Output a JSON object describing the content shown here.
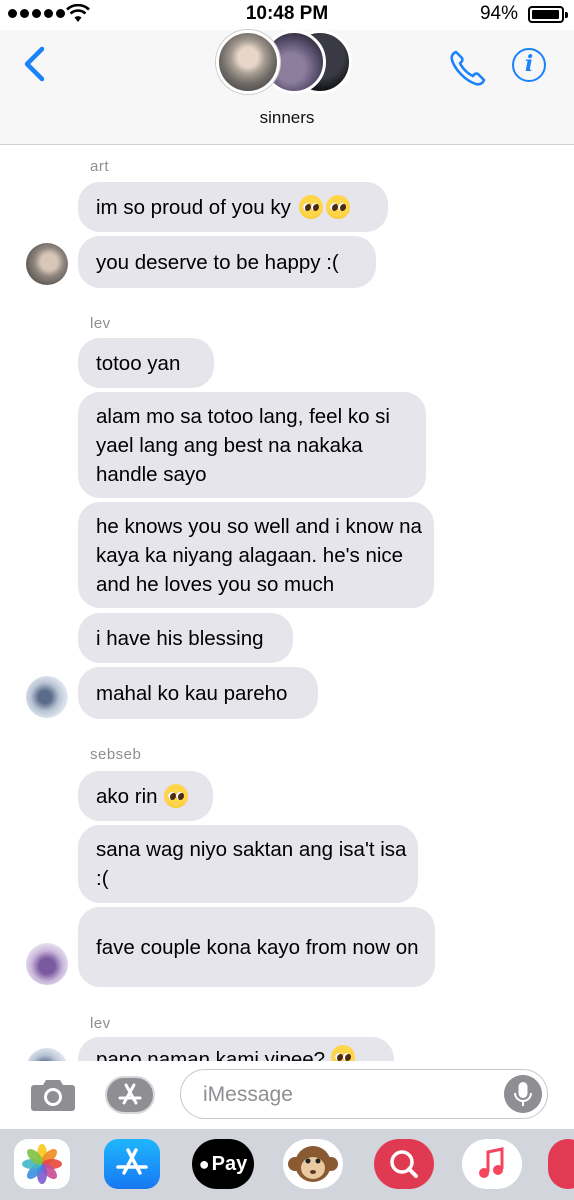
{
  "status_bar": {
    "time": "10:48 PM",
    "battery": "94%"
  },
  "header": {
    "group_name": "sinners"
  },
  "messages": [
    {
      "sender": "art",
      "bubbles": [
        "im so proud of you ky",
        "you deserve to be happy :("
      ]
    },
    {
      "sender": "lev",
      "bubbles": [
        "totoo yan",
        "alam mo sa totoo lang, feel ko si yael lang ang best na nakaka handle sayo",
        "he knows you so well and i know na kaya ka niyang alagaan. he's nice and he loves you so much",
        "i have his blessing",
        "mahal ko kau pareho"
      ]
    },
    {
      "sender": "sebseb",
      "bubbles": [
        "ako rin",
        "sana wag niyo saktan ang isa't isa :(",
        "fave couple kona kayo from now on"
      ]
    },
    {
      "sender": "lev",
      "bubbles": [
        "pano naman kami yipee?"
      ]
    }
  ],
  "composer": {
    "placeholder": "iMessage"
  },
  "app_drawer": {
    "apple_pay_label": "Pay"
  },
  "colors": {
    "accent": "#1a82fb",
    "bubble": "#e6e5eb",
    "drawer": "#d2d5db"
  }
}
